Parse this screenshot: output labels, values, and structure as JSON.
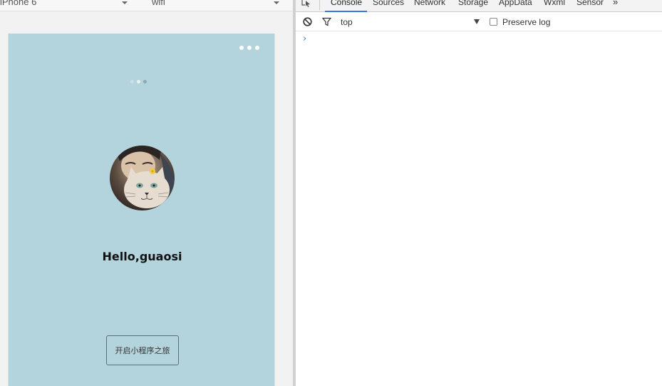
{
  "device_bar": {
    "device": "iPhone 6",
    "network": "wifi"
  },
  "phone": {
    "background_color": "#b4d4dd",
    "loading_dot_colors": [
      "#c9e0e6",
      "#e9f2f4",
      "#8fa9b0"
    ],
    "greeting": "Hello,guaosi",
    "start_button_label": "开启小程序之旅"
  },
  "devtools": {
    "tabs": [
      "Console",
      "Sources",
      "Network",
      "Storage",
      "AppData",
      "Wxml",
      "Sensor"
    ],
    "active_tab": "Console",
    "more_tabs": "»",
    "toolbar": {
      "context": "top",
      "preserve_log_label": "Preserve log",
      "preserve_log_checked": false
    },
    "prompt": "›"
  }
}
